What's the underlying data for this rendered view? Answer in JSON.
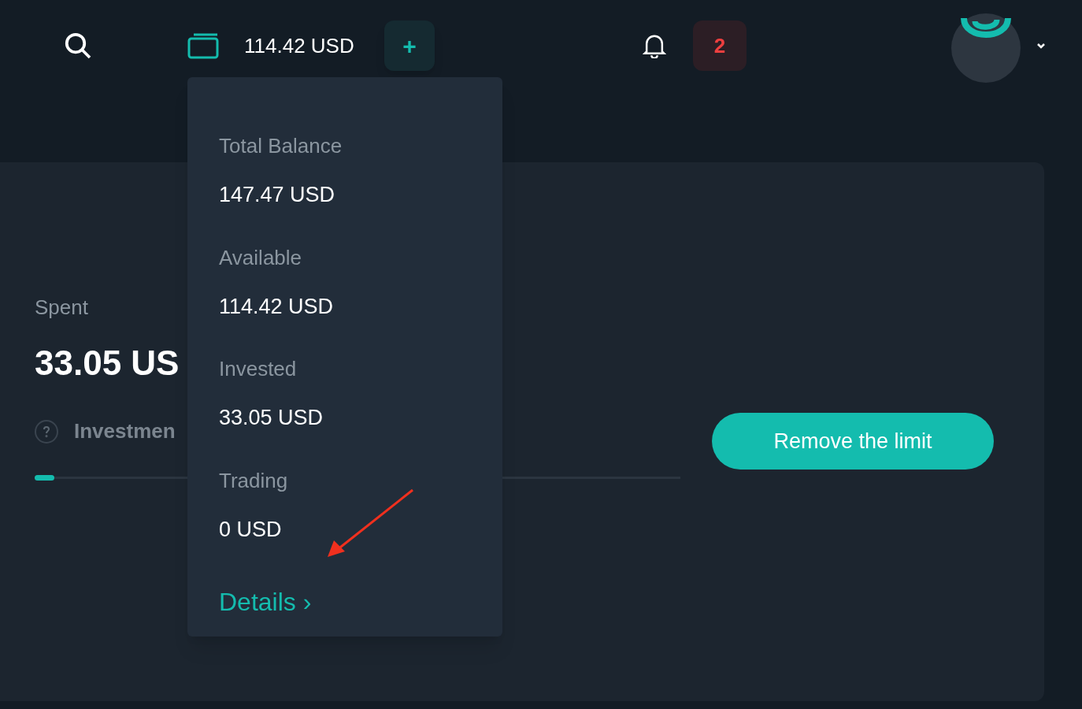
{
  "header": {
    "balance": "114.42 USD",
    "add_button": "+",
    "notifications_count": "2"
  },
  "balance_menu": {
    "items": [
      {
        "label": "Total Balance",
        "value": "147.47 USD"
      },
      {
        "label": "Available",
        "value": "114.42 USD"
      },
      {
        "label": "Invested",
        "value": "33.05 USD"
      },
      {
        "label": "Trading",
        "value": "0 USD"
      }
    ],
    "details_link": "Details ›"
  },
  "limit_card": {
    "label": "Spent",
    "amount": "33.05 US",
    "limit_label": "Investmen",
    "progress": {
      "level": 0.03
    },
    "button": "Remove the limit"
  }
}
